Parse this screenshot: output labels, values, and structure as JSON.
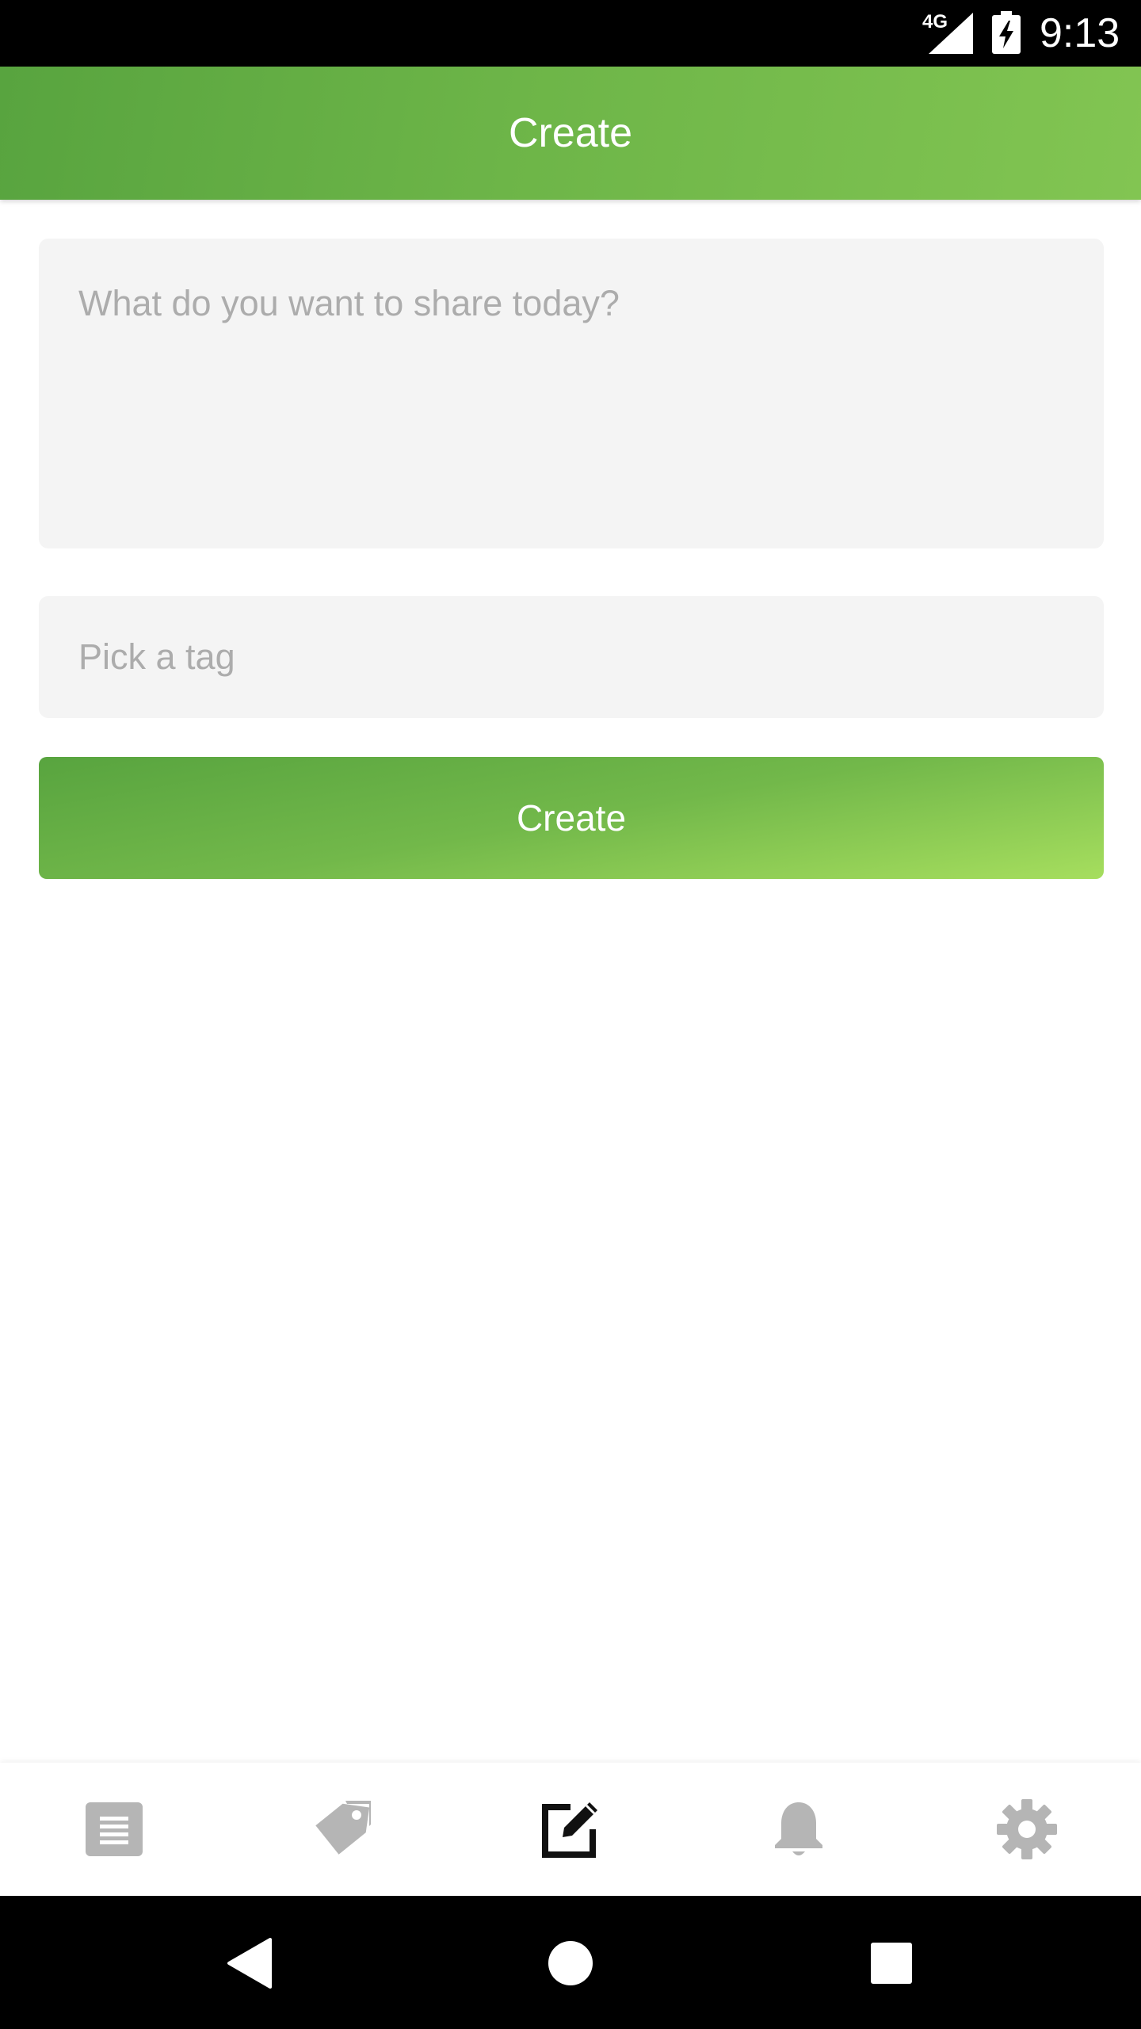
{
  "status_bar": {
    "network": "4G",
    "time": "9:13"
  },
  "app_bar": {
    "title": "Create"
  },
  "form": {
    "post_placeholder": "What do you want to share today?",
    "post_value": "",
    "tag_placeholder": "Pick a tag",
    "tag_value": "",
    "create_label": "Create"
  },
  "bottom_nav": {
    "items": [
      {
        "icon": "feed-icon",
        "active": false
      },
      {
        "icon": "tags-icon",
        "active": false
      },
      {
        "icon": "create-icon",
        "active": true
      },
      {
        "icon": "bell-icon",
        "active": false
      },
      {
        "icon": "gear-icon",
        "active": false
      }
    ]
  },
  "system_nav": {
    "buttons": [
      "back-icon",
      "home-icon",
      "recents-icon"
    ]
  },
  "colors": {
    "brand_green": "#6db548",
    "inactive_icon": "#b5b5b5",
    "active_icon": "#111111",
    "input_background": "#f4f4f4",
    "placeholder": "#acacac"
  }
}
